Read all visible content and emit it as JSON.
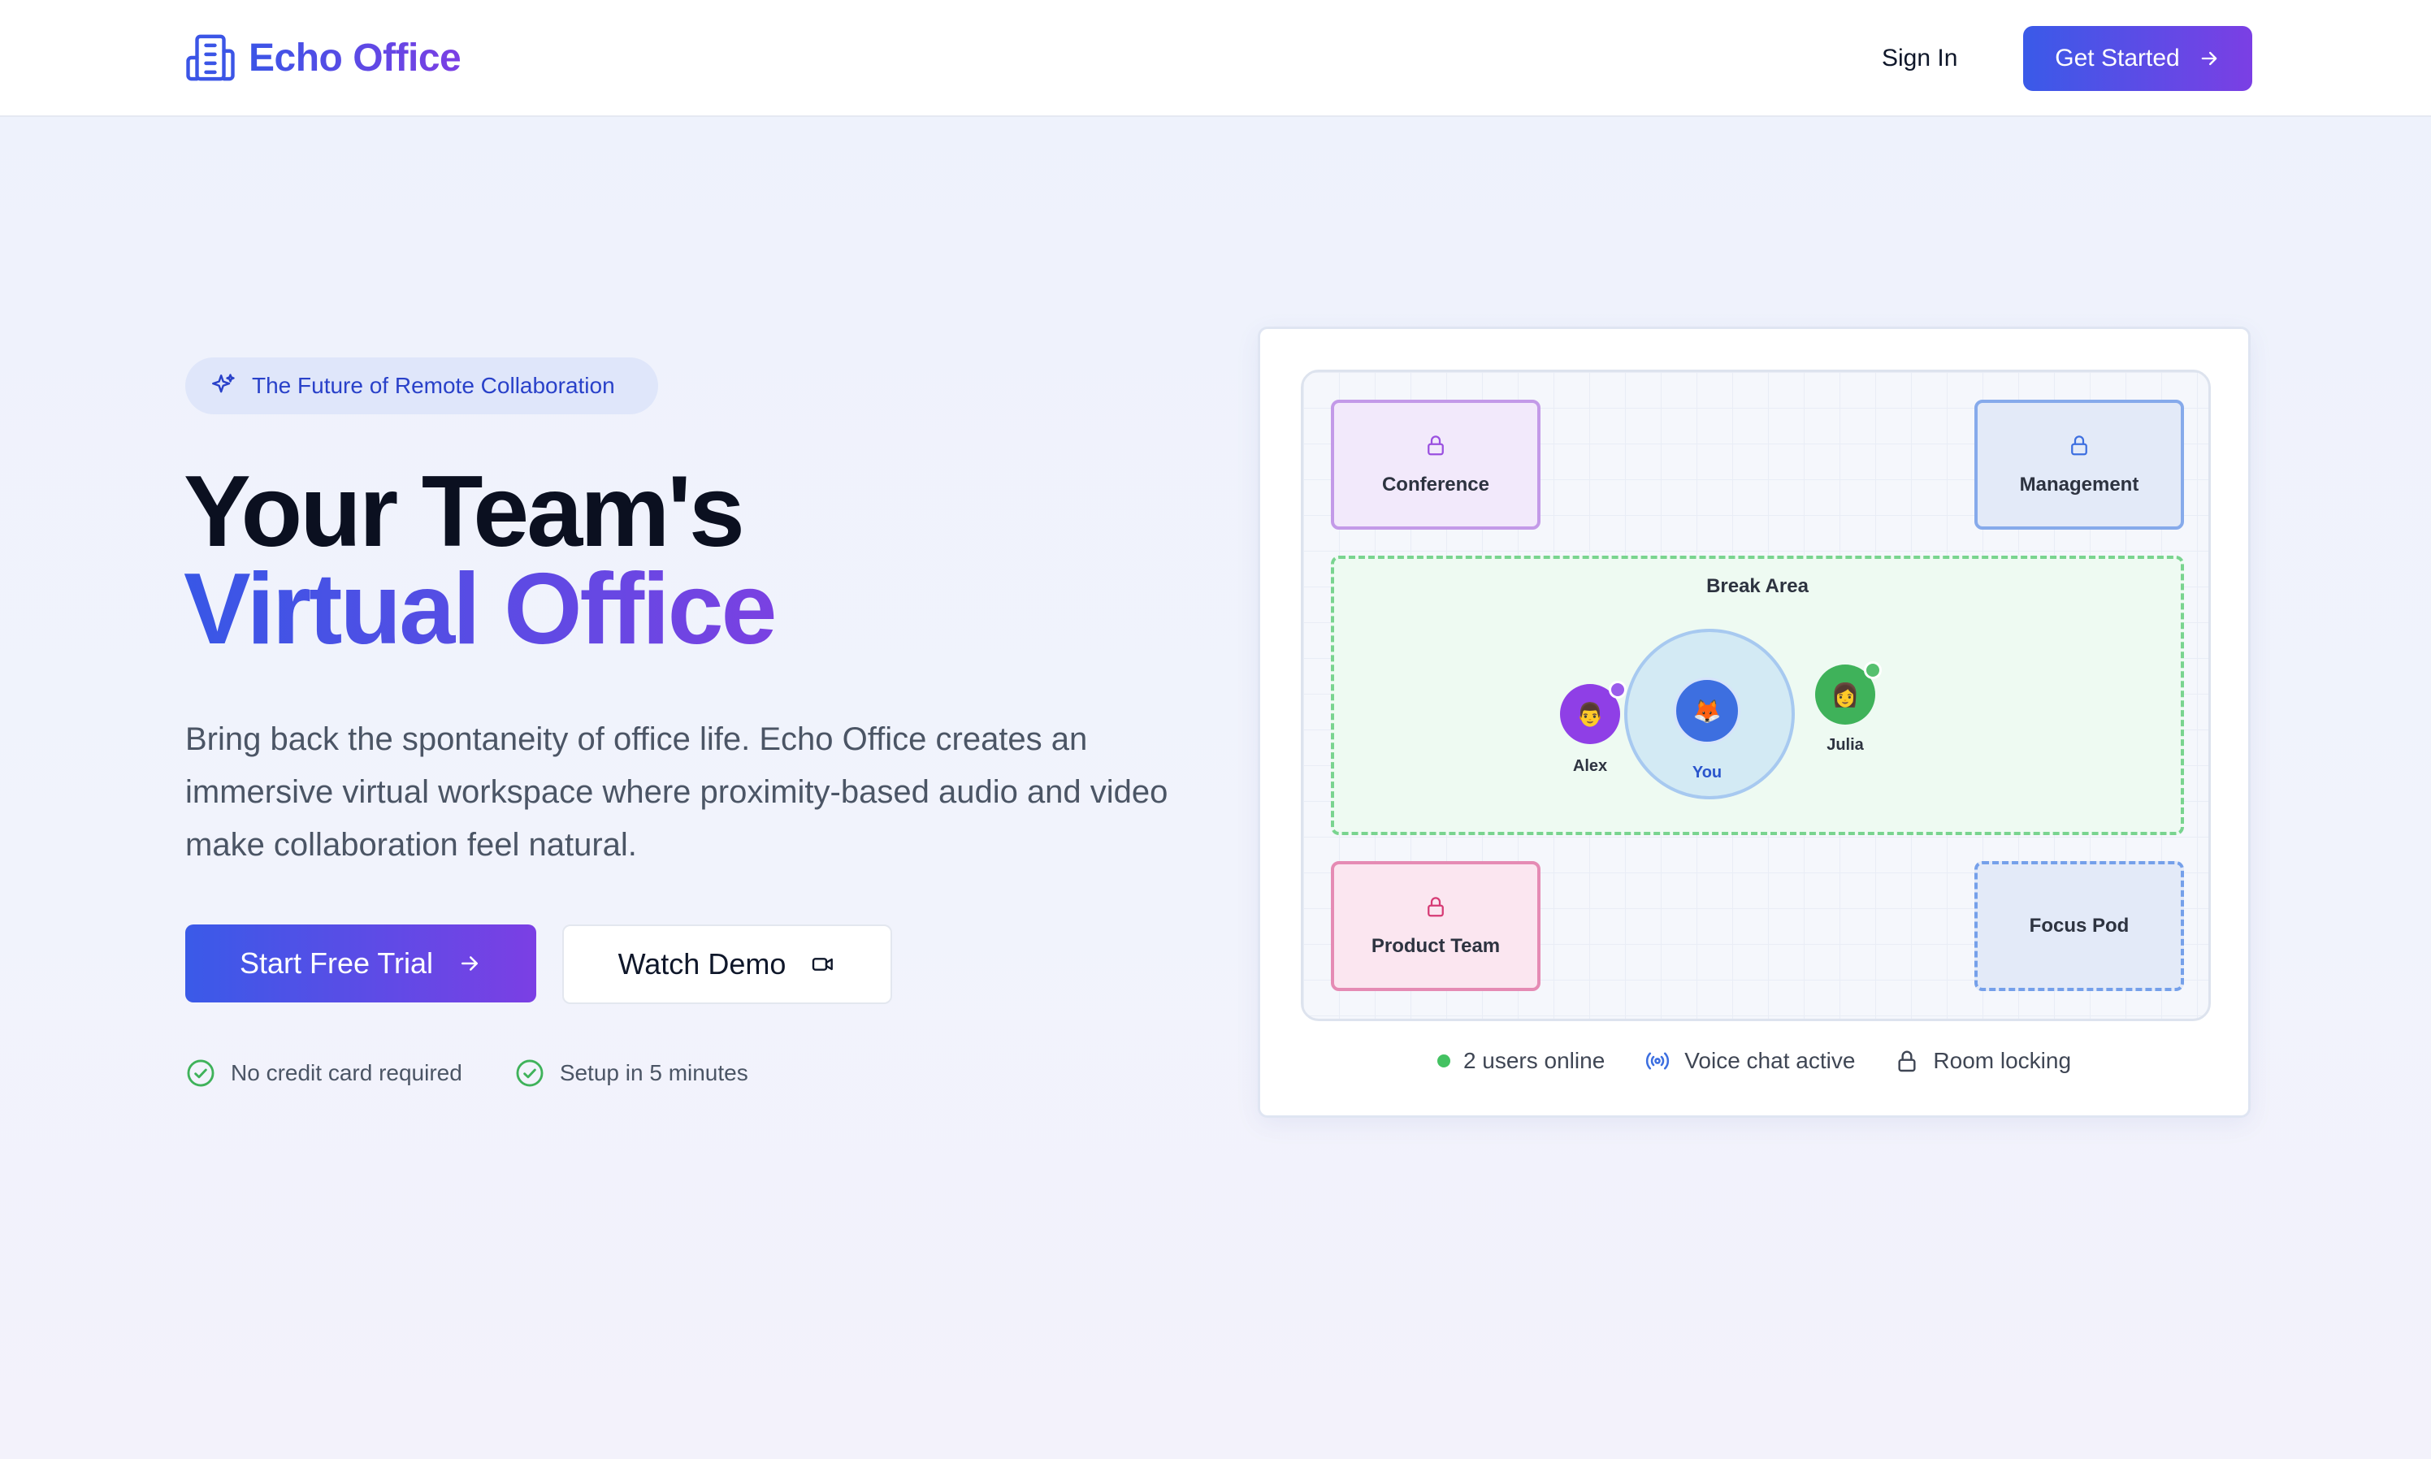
{
  "nav": {
    "brand": "Echo Office",
    "sign_in": "Sign In",
    "get_started": "Get Started"
  },
  "hero": {
    "pill_text": "The Future of Remote Collaboration",
    "headline_line1": "Your Team's",
    "headline_line2": "Virtual Office",
    "description": "Bring back the spontaneity of office life. Echo Office creates an immersive virtual workspace where proximity-based audio and video make collaboration feel natural.",
    "cta_primary": "Start Free Trial",
    "cta_secondary": "Watch Demo",
    "checks": [
      "No credit card required",
      "Setup in 5 minutes"
    ]
  },
  "office_map": {
    "rooms": {
      "conference": "Conference",
      "management": "Management",
      "product": "Product Team",
      "focus": "Focus Pod"
    },
    "break_area": {
      "title": "Break Area",
      "avatars": [
        {
          "name": "Alex",
          "emoji": "👨"
        },
        {
          "name": "You",
          "emoji": "🦊"
        },
        {
          "name": "Julia",
          "emoji": "👩"
        }
      ]
    },
    "status": {
      "online": "2 users online",
      "voice": "Voice chat active",
      "locking": "Room locking"
    }
  },
  "colors": {
    "brand_blue": "#3a5ae8",
    "brand_purple": "#7b3fe4",
    "online_green": "#44c262"
  }
}
